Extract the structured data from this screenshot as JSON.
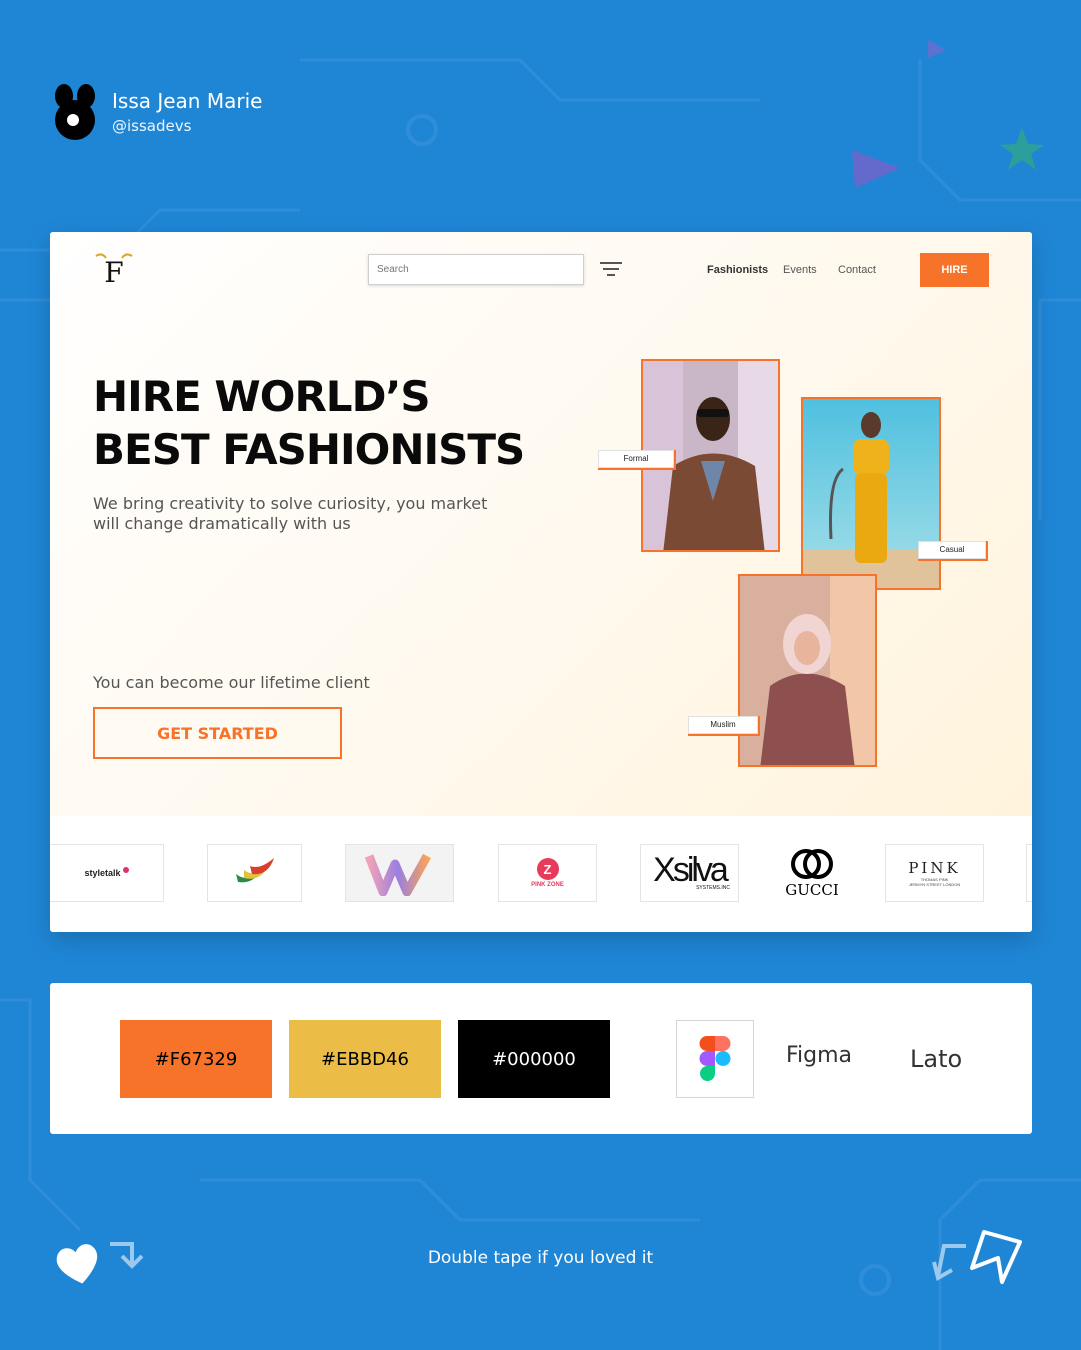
{
  "author": {
    "name": "Issa Jean Marie",
    "handle": "@issadevs"
  },
  "header": {
    "search_placeholder": "Search",
    "nav": [
      "Fashionists",
      "Events",
      "Contact"
    ],
    "hire_label": "HIRE"
  },
  "hero": {
    "headline_line1": "HIRE WORLD’S",
    "headline_line2": "BEST FASHIONISTS",
    "subtitle": "We bring creativity to solve curiosity, you market will change dramatically with us",
    "lifetime_text": "You can become our lifetime client",
    "cta_label": "GET STARTED",
    "tags": {
      "formal": "Formal",
      "casual": "Casual",
      "muslim": "Muslim"
    }
  },
  "brands": {
    "styletalk": "styletalk",
    "pinkzone": "PINK ZONE",
    "xsilva": "Xsilva",
    "xsilva_sub": "SYSTEMS.INC",
    "gucci": "GUCCI",
    "pink": "PINK",
    "pink_sub1": "THOMAS PINK",
    "pink_sub2": "JERMYN STREET LONDON"
  },
  "palette": {
    "colors": [
      {
        "label": "#F67329",
        "hex": "#F67329",
        "text": "#000000"
      },
      {
        "label": "#EBBD46",
        "hex": "#EBBD46",
        "text": "#000000"
      },
      {
        "label": "#000000",
        "hex": "#000000",
        "text": "#ffffff"
      }
    ],
    "tool": "Figma",
    "font": "Lato"
  },
  "footer": {
    "text": "Double tape if you loved it"
  },
  "colors": {
    "accent": "#f67329",
    "background": "#1f86d6"
  }
}
